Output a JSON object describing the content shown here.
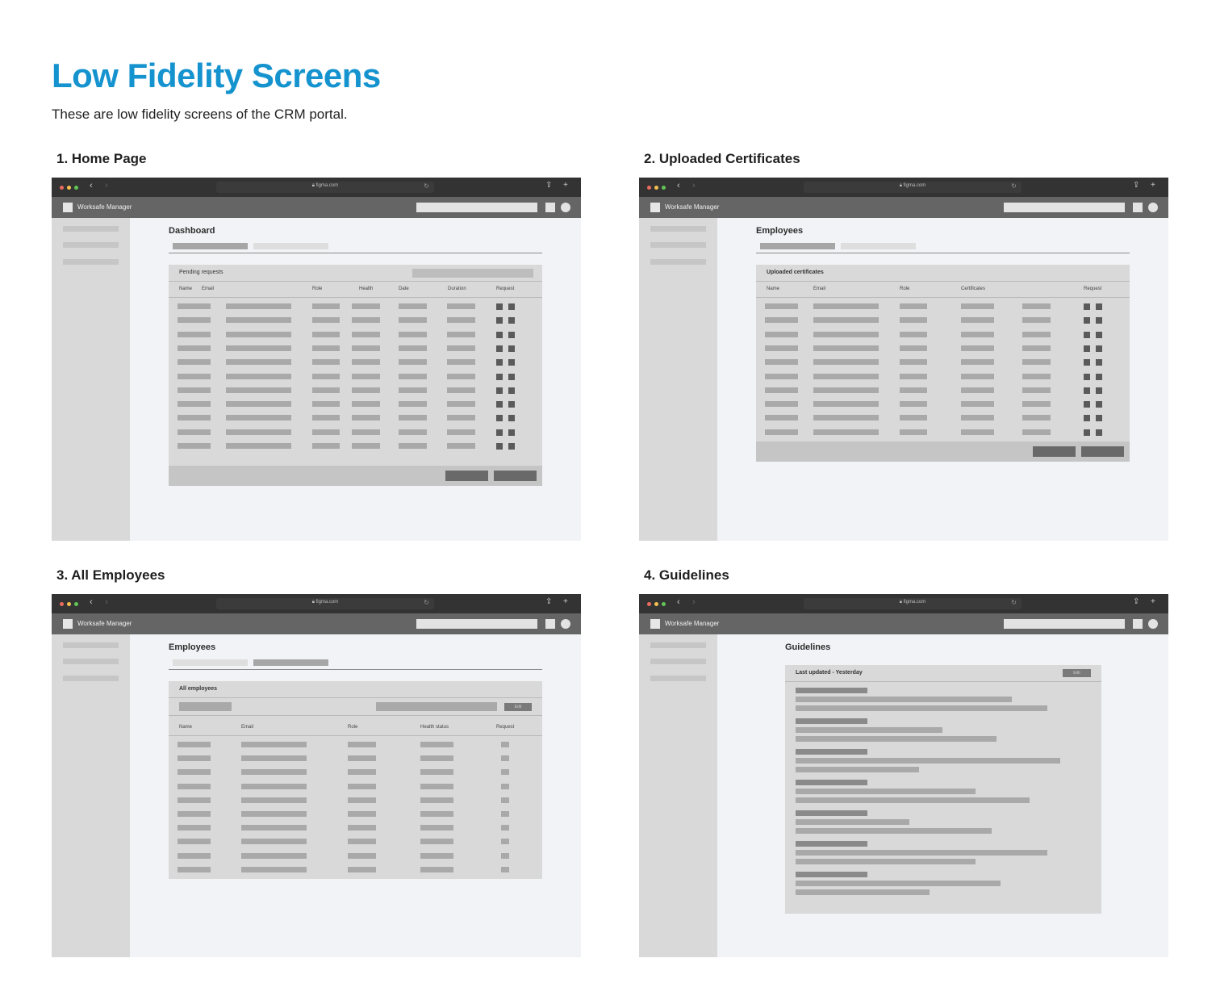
{
  "page": {
    "title": "Low Fidelity Screens",
    "subtitle": "These are low fidelity screens of the CRM portal."
  },
  "browser_chrome": {
    "url": "figma.com",
    "back_icon": "chevron-left-icon",
    "forward_icon": "chevron-right-icon",
    "share_icon": "share-icon",
    "new_tab_icon": "plus-icon",
    "traffic_light_colors": [
      "#ed6a5e",
      "#f5bf4f",
      "#61c554"
    ]
  },
  "app": {
    "name": "Worksafe Manager"
  },
  "screens": {
    "home": {
      "label": "1. Home Page",
      "page_title": "Dashboard",
      "panel_title": "Pending requests",
      "columns": [
        "Name",
        "Email",
        "Role",
        "Health",
        "Date",
        "Duration",
        "Request"
      ]
    },
    "certs": {
      "label": "2. Uploaded Certificates",
      "page_title": "Employees",
      "panel_title": "Uploaded certificates",
      "columns": [
        "Name",
        "Email",
        "Role",
        "Certificates",
        "Request"
      ]
    },
    "employees": {
      "label": "3. All Employees",
      "page_title": "Employees",
      "panel_title": "All employees",
      "edit_label": "Edit",
      "columns": [
        "Name",
        "Email",
        "Role",
        "Health status",
        "Request"
      ]
    },
    "guidelines": {
      "label": "4. Guidelines",
      "page_title": "Guidelines",
      "panel_title": "Last updated - Yesterday",
      "edit_label": "Edit"
    }
  }
}
